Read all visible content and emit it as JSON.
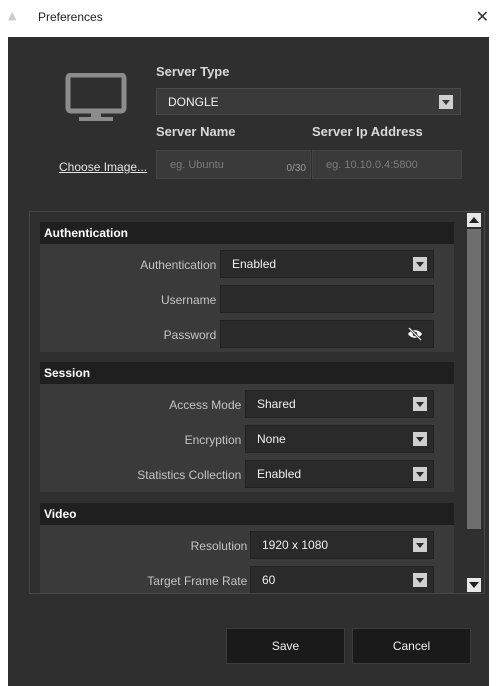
{
  "window": {
    "title": "Preferences",
    "close_glyph": "✕"
  },
  "server": {
    "type_label": "Server Type",
    "type_value": "DONGLE",
    "name_label": "Server Name",
    "name_placeholder": "eg. Ubuntu",
    "name_counter": "0/30",
    "ip_label": "Server Ip Address",
    "ip_placeholder": "eg. 10.10.0.4:5800",
    "choose_image": "Choose Image..."
  },
  "sections": {
    "authentication": {
      "title": "Authentication",
      "auth_label": "Authentication :",
      "auth_value": "Enabled",
      "username_label": "Username :",
      "password_label": "Password :"
    },
    "session": {
      "title": "Session",
      "access_label": "Access Mode :",
      "access_value": "Shared",
      "encryption_label": "Encryption :",
      "encryption_value": "None",
      "stats_label": "Statistics Collection :",
      "stats_value": "Enabled"
    },
    "video": {
      "title": "Video",
      "resolution_label": "Resolution :",
      "resolution_value": "1920 x 1080",
      "framerate_label": "Target Frame Rate :",
      "framerate_value": "60"
    }
  },
  "buttons": {
    "save": "Save",
    "cancel": "Cancel"
  },
  "icons": {
    "monitor": "monitor-icon",
    "eye_off": "eye-off-icon",
    "dropdown": "chevron-down-icon"
  },
  "colors": {
    "background": "#2f2f2f",
    "section_header": "#1f1f1f",
    "section_body": "#3a3a3a",
    "input": "#2a2a2a"
  }
}
